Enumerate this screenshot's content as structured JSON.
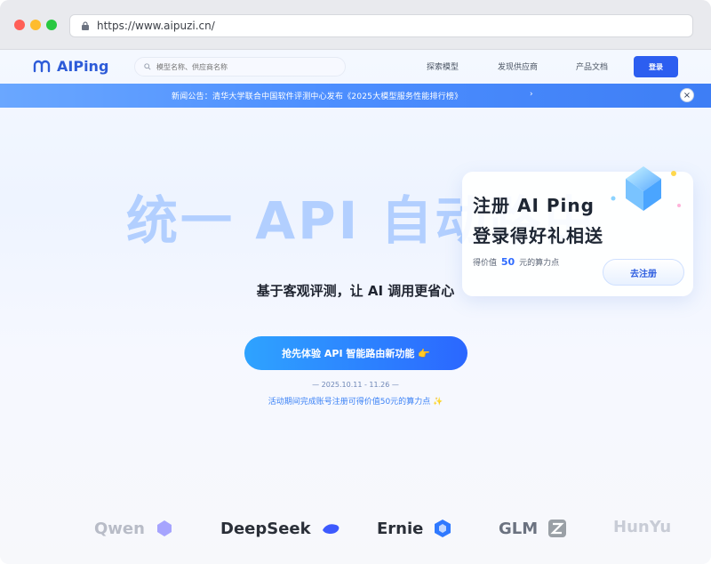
{
  "browser": {
    "url": "https://www.aipuzi.cn/"
  },
  "nav": {
    "brand": "AIPing",
    "search_placeholder": "模型名称、供应商名称",
    "links": [
      "探索模型",
      "发现供应商",
      "产品文档"
    ],
    "login": "登录"
  },
  "announcement": {
    "text": "新闻公告：清华大学联合中国软件评测中心发布《2025大模型服务性能排行榜》",
    "arrow": "›",
    "close": "×"
  },
  "hero": {
    "big_title": "统一 API 自动路由",
    "subtitle": "基于客观评测，让 AI 调用更省心",
    "cta": "抢先体验 API 智能路由新功能 👉",
    "date_range": "— 2025.10.11 - 11.26 —",
    "promo": "活动期间完成账号注册可得价值50元的算力点 ✨"
  },
  "popup": {
    "title_line1": "注册 AI Ping",
    "title_line2": "登录得好礼相送",
    "note_prefix": "得价值",
    "note_value": "50",
    "note_suffix": "元的算力点",
    "button": "去注册"
  },
  "partners": [
    {
      "name": "Qwen",
      "color": "#b8bcc7",
      "icon_color": "#8b88ff"
    },
    {
      "name": "DeepSeek",
      "color": "#2a2f38",
      "icon_color": "#3d5afe"
    },
    {
      "name": "Ernie",
      "color": "#2a2f38",
      "icon_color": "#2f79ff"
    },
    {
      "name": "GLM",
      "color": "#6b7280",
      "icon_color": "#9aa0a6"
    },
    {
      "name": "HunYu",
      "color": "#c8ccd6",
      "icon_color": "#e5e7eb"
    }
  ]
}
